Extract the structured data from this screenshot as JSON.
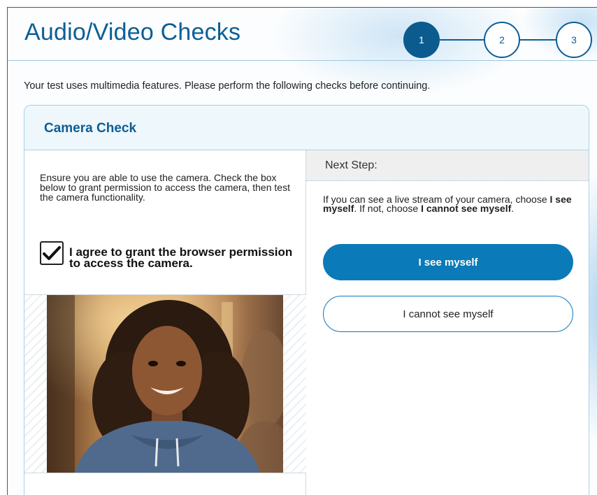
{
  "header": {
    "title": "Audio/Video Checks",
    "steps": [
      {
        "label": "1",
        "state": "active"
      },
      {
        "label": "2",
        "state": "upcoming"
      },
      {
        "label": "3",
        "state": "upcoming"
      }
    ]
  },
  "intro_text": "Your test uses multimedia features. Please perform the following checks before continuing.",
  "card": {
    "title": "Camera Check",
    "instructions": "Ensure you are able to use the camera. Check the box below to grant permission to access the camera, then test the camera functionality.",
    "consent": {
      "checked": true,
      "label": "I agree to grant the browser permission to access the camera."
    },
    "camera_feed_icon": "live-camera-feed",
    "next_step": {
      "label": "Next Step:",
      "text_part1": "If you can see a live stream of your camera, choose ",
      "text_bold1": "I see myself",
      "text_part2": ". If not, choose ",
      "text_bold2": "I cannot see myself",
      "text_part3": ".",
      "primary_button": "I see myself",
      "secondary_button": "I cannot see myself"
    }
  },
  "colors": {
    "brand_blue": "#0d5e94",
    "button_blue": "#0b7ab8",
    "card_border": "#a9d2e8"
  }
}
